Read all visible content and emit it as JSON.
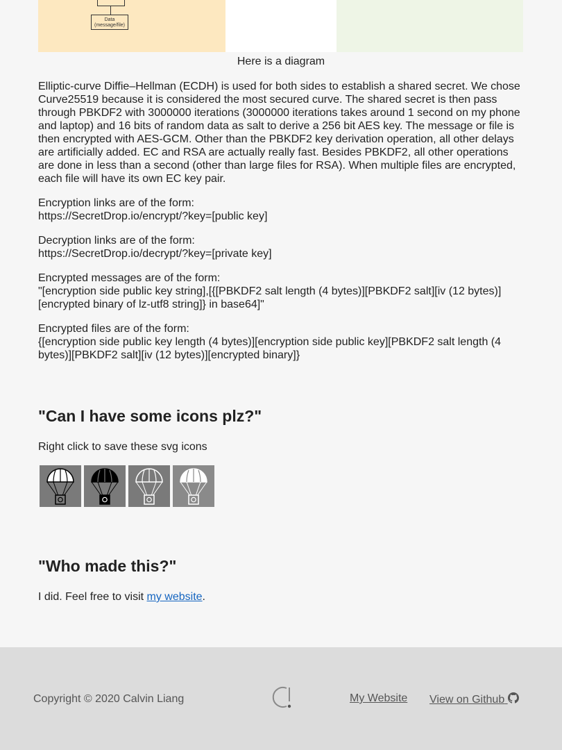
{
  "diagram": {
    "data_box_label_line1": "Data",
    "data_box_label_line2": "(message/file)",
    "caption": "Here is a diagram"
  },
  "explanation": {
    "paragraph": "Elliptic-curve Diffie–Hellman (ECDH) is used for both sides to establish a shared secret. We chose Curve25519 because it is considered the most secured curve. The shared secret is then pass through PBKDF2 with 3000000 iterations (3000000 iterations takes around 1 second on my phone and laptop) and 16 bits of random data as salt to derive a 256 bit AES key. The message or file is then encrypted with AES-GCM. Other than the PBKDF2 key derivation operation, all other delays are artificially added. EC and RSA are actually really fast. Besides PBKDF2, all other operations are done in less than a second (other than large files for RSA). When multiple files are encrypted, each file will have its own EC key pair.",
    "enc_links_label": "Encryption links are of the form:",
    "enc_links_value": "https://SecretDrop.io/encrypt/?key=[public key]",
    "dec_links_label": "Decryption links are of the form:",
    "dec_links_value": "https://SecretDrop.io/decrypt/?key=[private key]",
    "enc_msgs_label": "Encrypted messages are of the form:",
    "enc_msgs_value": "\"[encryption side public key string],[{[PBKDF2 salt length (4 bytes)][PBKDF2 salt][iv (12 bytes)][encrypted binary of lz-utf8 string]} in base64]\"",
    "enc_files_label": "Encrypted files are of the form:",
    "enc_files_value": "{[encryption side public key length (4 bytes)][encryption side public key][PBKDF2 salt length (4 bytes)][PBKDF2 salt][iv (12 bytes)][encrypted binary]}"
  },
  "icons_section": {
    "heading": "\"Can I have some icons plz?\"",
    "text": "Right click to save these svg icons",
    "icons": [
      {
        "name": "parachute-icon-dark-outline",
        "canopy": "#ffffff",
        "stroke": "#000000",
        "bg": "#7a7a7a"
      },
      {
        "name": "parachute-icon-dark-filled",
        "canopy": "#000000",
        "stroke": "#000000",
        "bg": "#7a7a7a"
      },
      {
        "name": "parachute-icon-light-outline",
        "canopy": "#7a7a7a",
        "stroke": "#ffffff",
        "bg": "#7a7a7a"
      },
      {
        "name": "parachute-icon-light-filled",
        "canopy": "#ffffff",
        "stroke": "#ffffff",
        "bg": "#8a8a8a"
      }
    ]
  },
  "who_section": {
    "heading": "\"Who made this?\"",
    "text_before": "I did. Feel free to visit ",
    "link_label": "my website",
    "text_after": "."
  },
  "footer": {
    "copyright": "Copyright © 2020 Calvin Liang",
    "logo_icon": "secretdrop-logo-icon",
    "my_website": "My Website",
    "github": "View on Github",
    "github_icon": "github-icon"
  }
}
